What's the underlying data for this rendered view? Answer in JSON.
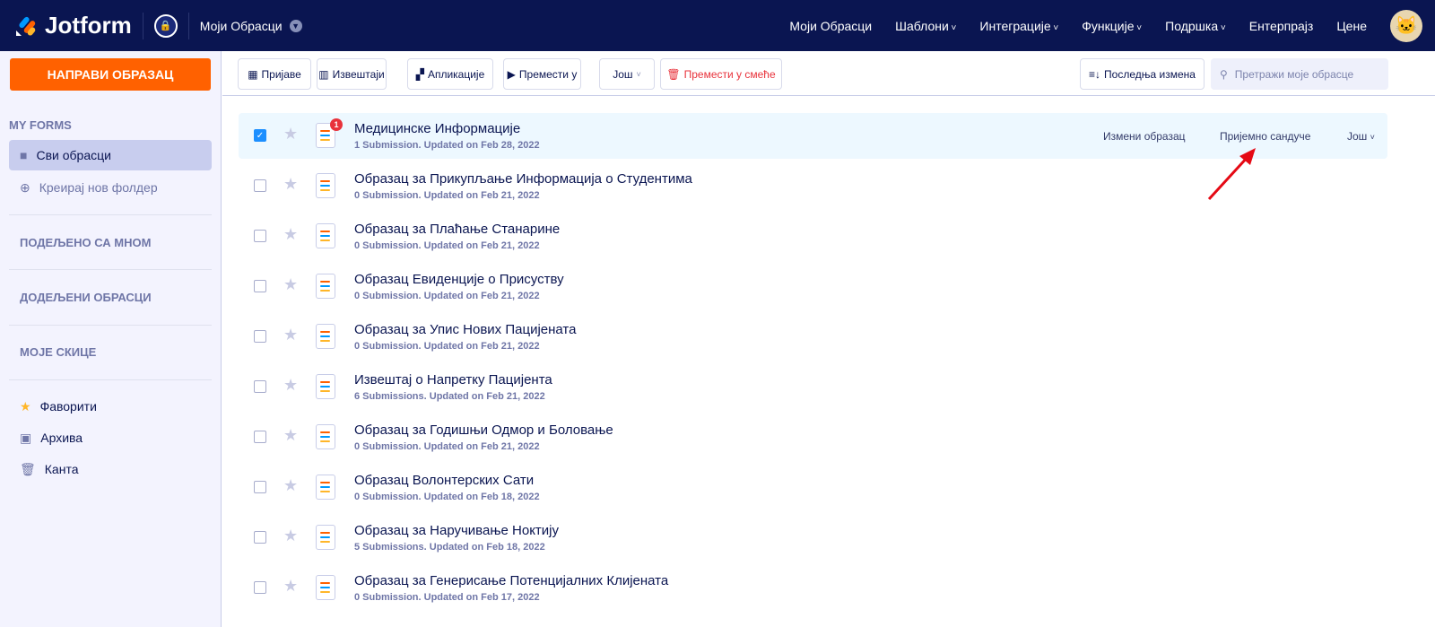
{
  "header": {
    "brand": "Jotform",
    "my_forms": "Моји Обрасци",
    "nav": [
      "Моји Обрасци",
      "Шаблони",
      "Интеграције",
      "Функције",
      "Подршка",
      "Ентерпрајз",
      "Цене"
    ]
  },
  "sidebar": {
    "create_label": "НАПРАВИ ОБРАЗАЦ",
    "heading": "MY FORMS",
    "all_forms": "Сви обрасци",
    "new_folder": "Креирај нов фолдер",
    "shared": "ПОДЕЉЕНО СА МНОМ",
    "assigned": "ДОДЕЉЕНИ ОБРАСЦИ",
    "drafts": "МОЈЕ СКИЦЕ",
    "favorites": "Фаворити",
    "archive": "Архива",
    "trash": "Канта"
  },
  "toolbar": {
    "submissions": "Пријаве",
    "reports": "Извештаји",
    "apps": "Апликације",
    "move_to": "Премести у",
    "more": "Још",
    "trash": "Премести у смеће",
    "sort": "Последња измена",
    "search_placeholder": "Претражи моје обрасце"
  },
  "row_actions": {
    "edit": "Измени образац",
    "inbox": "Пријемно сандуче",
    "more": "Још"
  },
  "forms": [
    {
      "title": "Медицинске Информације",
      "sub": "1 Submission. Updated on Feb 28, 2022",
      "selected": true,
      "badge": "1"
    },
    {
      "title": "Образац за Прикупљање Информација о Студентима",
      "sub": "0 Submission. Updated on Feb 21, 2022"
    },
    {
      "title": "Образац за Плаћање Станарине",
      "sub": "0 Submission. Updated on Feb 21, 2022"
    },
    {
      "title": "Образац Евиденције о Присуству",
      "sub": "0 Submission. Updated on Feb 21, 2022"
    },
    {
      "title": "Образац за Упис Нових Пацијената",
      "sub": "0 Submission. Updated on Feb 21, 2022"
    },
    {
      "title": "Извештај о Напретку Пацијента",
      "sub": "6 Submissions. Updated on Feb 21, 2022"
    },
    {
      "title": "Образац за Годишњи Одмор и Боловање",
      "sub": "0 Submission. Updated on Feb 21, 2022"
    },
    {
      "title": "Образац Волонтерских Сати",
      "sub": "0 Submission. Updated on Feb 18, 2022"
    },
    {
      "title": "Образац за Наручивање Ноктију",
      "sub": "5 Submissions. Updated on Feb 18, 2022"
    },
    {
      "title": "Образац за Генерисање Потенцијалних Клијената",
      "sub": "0 Submission. Updated on Feb 17, 2022"
    }
  ]
}
